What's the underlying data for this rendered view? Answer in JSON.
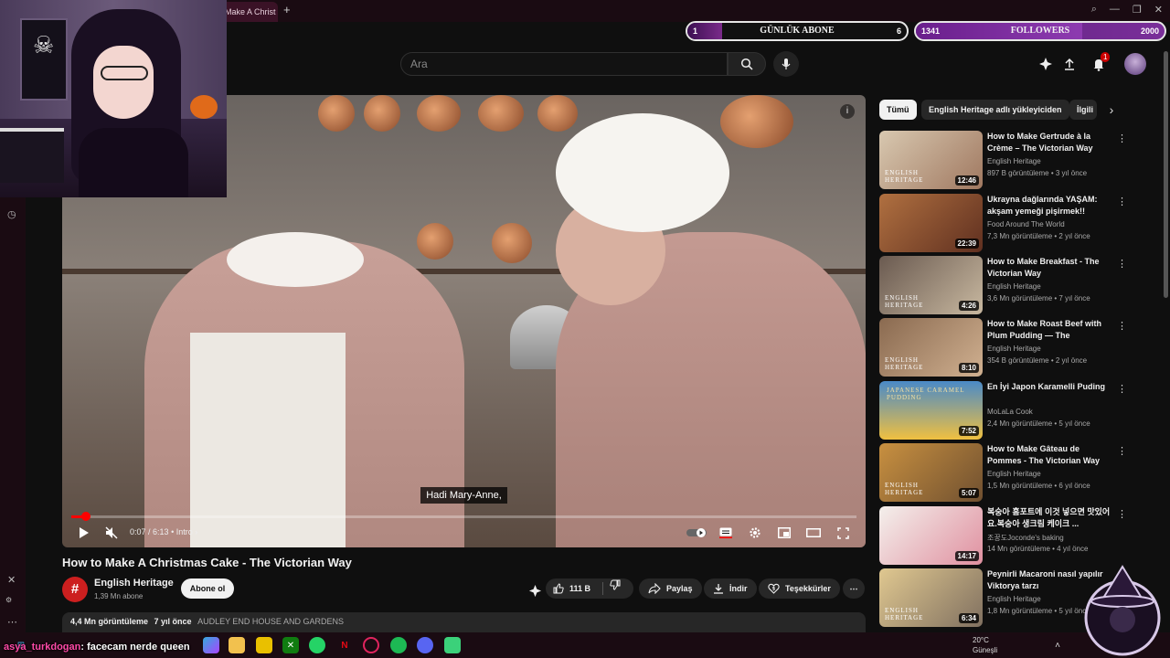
{
  "browser": {
    "tab_title": "Make A Christ",
    "new_tab": "+"
  },
  "overlays": {
    "abone": {
      "start": "1",
      "title": "GÜNLÜK ABONE",
      "goal": "6",
      "progress": 0.16
    },
    "followers": {
      "count": "1341",
      "title": "FOLLOWERS",
      "goal": "2000",
      "progress": 0.67
    }
  },
  "header": {
    "search_placeholder": "Ara",
    "notification_count": "1"
  },
  "player": {
    "subtitle": "Hadi Mary-Anne,",
    "time": "0:07 / 6:13",
    "chapter": "Intro",
    "progress": 0.019
  },
  "video": {
    "title": "How to Make A Christmas Cake - The Victorian Way",
    "channel": "English Heritage",
    "subscribers": "1,39 Mn abone",
    "subscribe_label": "Abone ol",
    "likes": "111 B",
    "share_label": "Paylaş",
    "download_label": "İndir",
    "thanks_label": "Teşekkürler",
    "views": "4,4 Mn görüntüleme",
    "age": "7 yıl önce",
    "location": "AUDLEY END HOUSE AND GARDENS"
  },
  "chips": [
    "Tümü",
    "English Heritage adlı yükleyiciden",
    "İlgili"
  ],
  "recommendations": [
    {
      "title": "How to Make Gertrude à la Crème – The Victorian Way",
      "channel": "English Heritage",
      "meta": "897 B görüntüleme • 3 yıl önce",
      "duration": "12:46"
    },
    {
      "title": "Ukrayna dağlarında YAŞAM: akşam yemeği pişirmek!!",
      "channel": "Food Around The World",
      "meta": "7,3 Mn görüntüleme • 2 yıl önce",
      "duration": "22:39"
    },
    {
      "title": "How to Make Breakfast - The Victorian Way",
      "channel": "English Heritage",
      "meta": "3,6 Mn görüntüleme • 7 yıl önce",
      "duration": "4:26"
    },
    {
      "title": "How to Make Roast Beef with Plum Pudding — The Victorian...",
      "channel": "English Heritage",
      "meta": "354 B görüntüleme • 2 yıl önce",
      "duration": "8:10"
    },
    {
      "title": "En İyi Japon Karamelli Puding",
      "channel": "MoLaLa Cook",
      "meta": "2,4 Mn görüntüleme • 5 yıl önce",
      "duration": "7:52"
    },
    {
      "title": "How to Make Gâteau de Pommes - The Victorian Way",
      "channel": "English Heritage",
      "meta": "1,5 Mn görüntüleme • 6 yıl önce",
      "duration": "5:07"
    },
    {
      "title": "복숭아 홈포트에 이것 넣으면 맛있어요.복숭아 생크림 케이크 ...",
      "channel": "조꿍도Joconde's baking",
      "meta": "14 Mn görüntüleme • 4 yıl önce",
      "duration": "14:17"
    },
    {
      "title": "Peynirli Macaroni nasıl yapılır Viktorya tarzı",
      "channel": "English Heritage",
      "meta": "1,8 Mn görüntüleme • 5 yıl önce",
      "duration": "6:34"
    }
  ],
  "thumb_captions": {
    "english_heritage": "ENGLISH HERITAGE",
    "caramel": "JAPANESE CARAMEL PUDDING"
  },
  "chat": {
    "user": "asya_turkdogan",
    "message": ": facecam nerde queen"
  },
  "weather": {
    "temp": "20°C",
    "condition": "Güneşli"
  },
  "colors": {
    "accent": "#ff0000",
    "brand": "#cc1f1f",
    "overlay_purple": "#7a2f9a",
    "chat_user": "#ff4aa8"
  }
}
